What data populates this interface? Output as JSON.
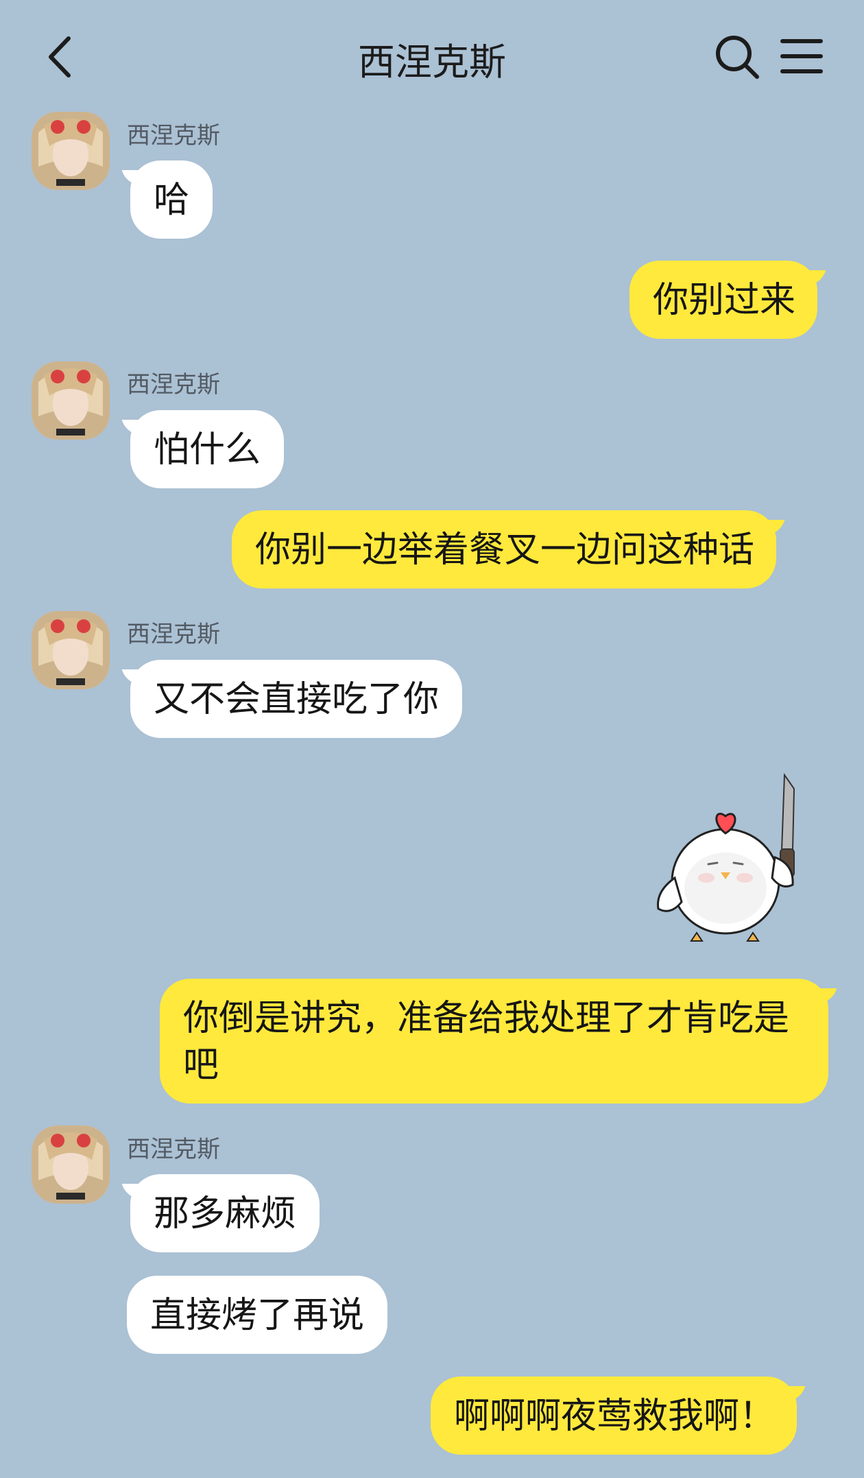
{
  "header": {
    "title": "西涅克斯"
  },
  "contact": {
    "name": "西涅克斯"
  },
  "messages": [
    {
      "side": "in",
      "text": "哈"
    },
    {
      "side": "out",
      "text": "你别过来"
    },
    {
      "side": "in",
      "text": "怕什么"
    },
    {
      "side": "out",
      "text": "你别一边举着餐叉一边问这种话"
    },
    {
      "side": "in",
      "text": "又不会直接吃了你"
    },
    {
      "side": "out",
      "sticker": "chick-with-knife-sticker"
    },
    {
      "side": "out",
      "text": "你倒是讲究，准备给我处理了才肯吃是吧"
    },
    {
      "side": "in",
      "text": "那多麻烦"
    },
    {
      "side": "in",
      "text": "直接烤了再说"
    },
    {
      "side": "out",
      "text": "啊啊啊夜莺救我啊！"
    }
  ],
  "colors": {
    "background": "#abc1d4",
    "incoming": "#ffffff",
    "outgoing": "#ffe93c"
  },
  "icons": {
    "back": "chevron-left-icon",
    "search": "search-icon",
    "menu": "menu-icon"
  }
}
